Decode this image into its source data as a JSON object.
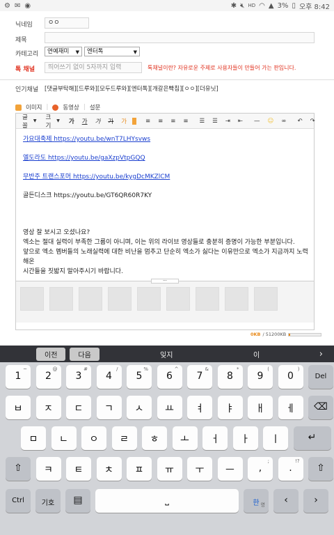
{
  "status": {
    "left_icons": [
      "settings-icon",
      "chat-icon",
      "game-icon"
    ],
    "right_icons": [
      "bluetooth-icon",
      "mute-icon",
      "hd-icon",
      "wifi-icon",
      "signal-icon",
      "battery-icon"
    ],
    "battery": "3%",
    "time": "오후 8:42"
  },
  "form": {
    "nickname_label": "닉네임",
    "nickname_value": "ㅇㅇ",
    "title_label": "제목",
    "title_value": "",
    "category_label": "카테고리",
    "category_1": "연예재미",
    "category_2": "엔터톡",
    "special_label": "톡 채널",
    "special_placeholder": "띄어쓰기 없이 5자까지 입력",
    "special_hint": "톡채널이란? 자유로운 주제로 사용자들이 만들어 가는 판입니다.",
    "popular_label": "인기채널",
    "popular_value": "[댓글부탁해][드루와][모두드루와][엔터톡][개갈은빡침][ㅇㅇ][더유닛]",
    "attach_image": "이미지",
    "attach_video": "동영상",
    "attach_poll": "설문"
  },
  "toolbar": {
    "font": "글꼴",
    "size": "크기",
    "items": [
      "가",
      "가",
      "가",
      "가",
      "가"
    ],
    "undo": "↶",
    "redo": "↷"
  },
  "content": {
    "links": [
      "가요대축제 https://youtu.be/wnT7LHYsvws",
      "엘도라도 https://youtu.be/gaXzpVtpGQQ",
      "무반주 트랜스포머 https://youtu.be/kygDcMKZlCM"
    ],
    "plain_link": "골든디스크 https://youtu.be/GT6QR60R7KY",
    "paragraphs": [
      "영상 잘 보시고 오셨나요?",
      "엑소는 절대 실력이 부족한 그룹이 아니며, 이는 위의 라이브 영상들로 충분히 증명이 가능한 부분입니다.",
      "앞으로 엑소 멤버들의 노래실력에 대한 비난을 멈추고 단순히 엑소가 싫다는 이유만으로 엑소가 지금까지 노력해온",
      "시간들을 짓밟지 말아주시기 바랍니다."
    ]
  },
  "size_indicator": {
    "used": "0KB",
    "total": "/ 51200KB",
    "fraction": 0.0
  },
  "keyboard": {
    "prev": "이전",
    "next": "다음",
    "suggestion_1": "잊지",
    "suggestion_2": "이",
    "number_row": [
      {
        "main": "1",
        "sub": "~"
      },
      {
        "main": "2",
        "sub": "@"
      },
      {
        "main": "3",
        "sub": "#"
      },
      {
        "main": "4",
        "sub": "/"
      },
      {
        "main": "5",
        "sub": "%"
      },
      {
        "main": "6",
        "sub": "^"
      },
      {
        "main": "7",
        "sub": "&"
      },
      {
        "main": "8",
        "sub": "*"
      },
      {
        "main": "9",
        "sub": "("
      },
      {
        "main": "0",
        "sub": ")"
      }
    ],
    "del": "Del",
    "row1": [
      "ㅂ",
      "ㅈ",
      "ㄷ",
      "ㄱ",
      "ㅅ",
      "ㅛ",
      "ㅕ",
      "ㅑ",
      "ㅐ",
      "ㅔ"
    ],
    "row2": [
      "ㅁ",
      "ㄴ",
      "ㅇ",
      "ㄹ",
      "ㅎ",
      "ㅗ",
      "ㅓ",
      "ㅏ",
      "ㅣ"
    ],
    "row3": [
      "ㅋ",
      "ㅌ",
      "ㅊ",
      "ㅍ",
      "ㅠ",
      "ㅜ",
      "ㅡ"
    ],
    "comma": ",",
    "comma_sub": ";",
    "period": ".",
    "period_sub": "!?",
    "ctrl": "Ctrl",
    "symbols": "기호",
    "lang_hangul": "한",
    "lang_english": "영"
  }
}
